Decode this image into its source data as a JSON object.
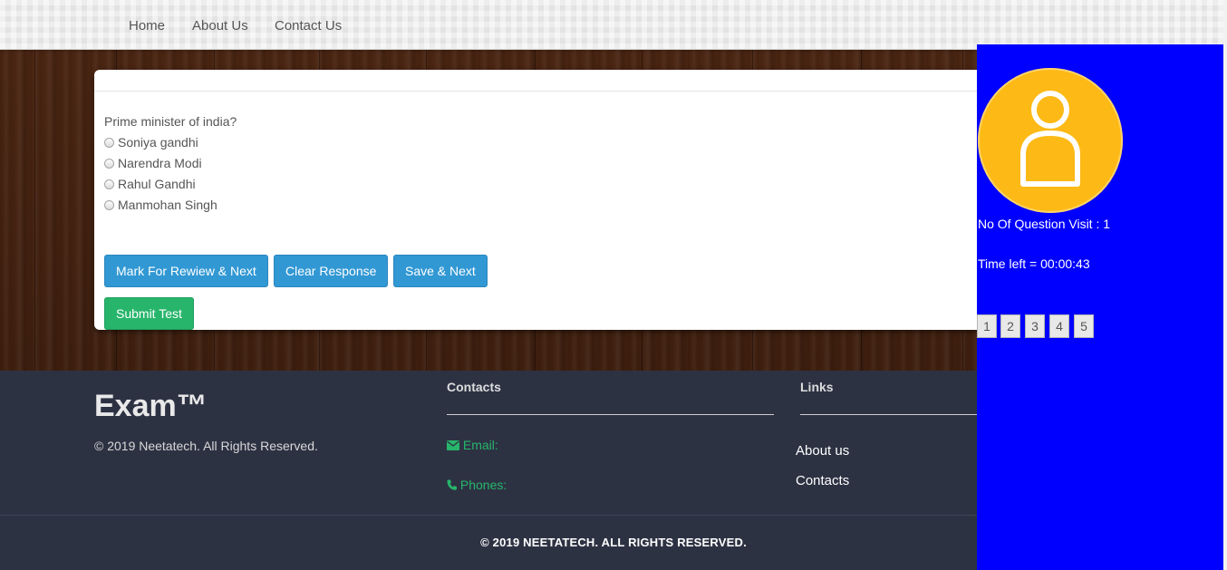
{
  "nav": {
    "items": [
      "Home",
      "About Us",
      "Contact Us"
    ]
  },
  "question": {
    "text": "Prime minister of india?",
    "options": [
      "Soniya gandhi",
      "Narendra Modi",
      "Rahul Gandhi",
      "Manmohan Singh"
    ]
  },
  "buttons": {
    "mark_review": "Mark For Rewiew & Next",
    "clear": "Clear Response",
    "save_next": "Save & Next",
    "submit": "Submit Test"
  },
  "sidebar": {
    "avatar_icon": "user-avatar-icon",
    "visits_text": "No Of Question Visit : 1",
    "timer_text": "Time left = 00:00:43",
    "question_numbers": [
      "1",
      "2",
      "3",
      "4",
      "5"
    ],
    "bg_color": "#0000ff",
    "avatar_color": "#fdb915"
  },
  "footer": {
    "brand": "Exam™",
    "copyright_small": "©  2019 Neetatech. All Rights Reserved.",
    "contacts_title": "Contacts",
    "email_label": "Email:",
    "phones_label": "Phones:",
    "links_title": "Links",
    "links": [
      "About us",
      "Contacts"
    ],
    "copyright_bottom": "© 2019 NEETATECH. ALL RIGHTS RESERVED."
  },
  "colors": {
    "primary_button": "#3198d4",
    "success_button": "#27b56b",
    "footer_bg": "#2d3243"
  }
}
